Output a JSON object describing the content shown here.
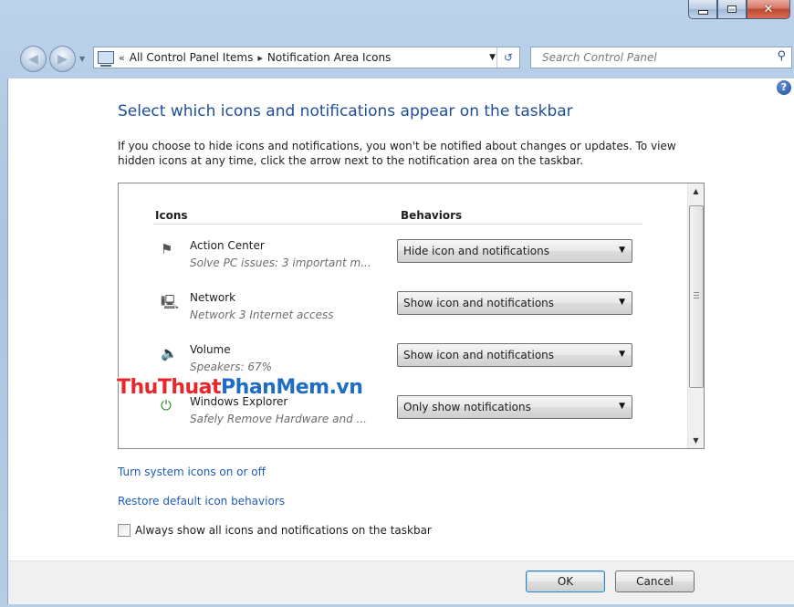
{
  "address": {
    "crumbs": [
      "All Control Panel Items",
      "Notification Area Icons"
    ]
  },
  "search": {
    "placeholder": "Search Control Panel"
  },
  "page": {
    "title": "Select which icons and notifications appear on the taskbar",
    "description": "If you choose to hide icons and notifications, you won't be notified about changes or updates. To view hidden icons at any time, click the arrow next to the notification area on the taskbar."
  },
  "table": {
    "header_icons": "Icons",
    "header_behaviors": "Behaviors",
    "rows": [
      {
        "name": "Action Center",
        "detail": "Solve PC issues: 3 important m...",
        "behavior": "Hide icon and notifications",
        "icon": "action-center-flag-icon"
      },
      {
        "name": "Network",
        "detail": "Network  3 Internet access",
        "behavior": "Show icon and notifications",
        "icon": "network-icon"
      },
      {
        "name": "Volume",
        "detail": "Speakers: 67%",
        "behavior": "Show icon and notifications",
        "icon": "speaker-icon"
      },
      {
        "name": "Windows Explorer",
        "detail": "Safely Remove Hardware and ...",
        "behavior": "Only show notifications",
        "icon": "usb-plug-icon"
      }
    ]
  },
  "links": {
    "system_icons": "Turn system icons on or off",
    "restore": "Restore default icon behaviors"
  },
  "checkbox": {
    "label": "Always show all icons and notifications on the taskbar",
    "checked": false
  },
  "watermark": {
    "part1": "ThuThuat",
    "part2": "PhanMem.vn"
  },
  "buttons": {
    "ok": "OK",
    "cancel": "Cancel"
  }
}
